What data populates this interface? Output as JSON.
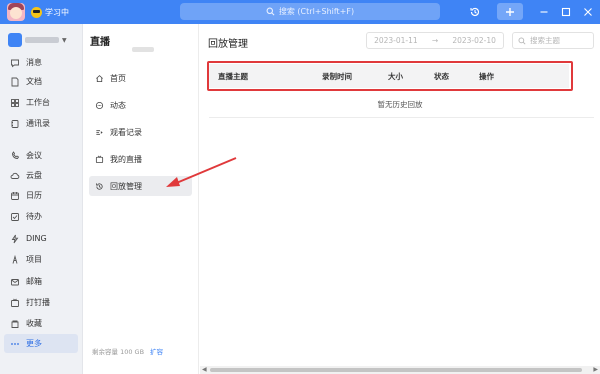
{
  "titlebar": {
    "status": "学习中",
    "search_placeholder": "搜索 (Ctrl+Shift+F)",
    "icons": [
      "history-icon",
      "plus-icon",
      "minimize-icon",
      "maximize-icon",
      "close-icon"
    ]
  },
  "sidebar": {
    "items": [
      {
        "label": "消息",
        "icon": "message-icon"
      },
      {
        "label": "文档",
        "icon": "document-icon"
      },
      {
        "label": "工作台",
        "icon": "workbench-icon"
      },
      {
        "label": "通讯录",
        "icon": "contacts-icon"
      },
      {
        "label": "会议",
        "icon": "meeting-icon"
      },
      {
        "label": "云盘",
        "icon": "cloud-icon"
      },
      {
        "label": "日历",
        "icon": "calendar-icon"
      },
      {
        "label": "待办",
        "icon": "todo-icon"
      },
      {
        "label": "DING",
        "icon": "ding-icon"
      },
      {
        "label": "项目",
        "icon": "project-icon"
      },
      {
        "label": "邮箱",
        "icon": "mail-icon"
      },
      {
        "label": "打钉播",
        "icon": "live-icon"
      },
      {
        "label": "收藏",
        "icon": "favorite-icon"
      },
      {
        "label": "更多",
        "icon": "more-icon"
      }
    ],
    "active": "更多"
  },
  "subnav": {
    "title": "直播",
    "items": [
      {
        "label": "首页",
        "icon": "home-icon"
      },
      {
        "label": "动态",
        "icon": "dynamic-icon"
      },
      {
        "label": "观看记录",
        "icon": "watch-history-icon"
      },
      {
        "label": "我的直播",
        "icon": "my-live-icon"
      },
      {
        "label": "回放管理",
        "icon": "replay-icon"
      }
    ],
    "active": "回放管理",
    "storage": "剩余容量 100 GB",
    "expand": "扩容"
  },
  "main": {
    "title": "回放管理",
    "date_start": "2023-01-11",
    "date_sep": "→",
    "date_end": "2023-02-10",
    "search_placeholder": "搜索主题",
    "columns": [
      "直播主题",
      "录制时间",
      "大小",
      "状态",
      "操作"
    ],
    "empty_text": "暂无历史回放"
  },
  "colors": {
    "accent": "#3f84f5",
    "highlight": "#e0393b"
  }
}
